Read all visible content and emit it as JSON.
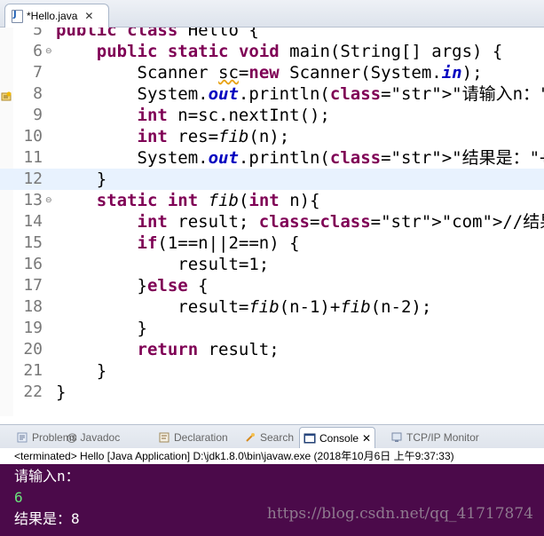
{
  "editor": {
    "tab": {
      "title": "*Hello.java",
      "close": "✕"
    },
    "current_line": "12",
    "lines": [
      {
        "num": "5",
        "text": "public class Hello {"
      },
      {
        "num": "6",
        "text": "    public static void main(String[] args) {"
      },
      {
        "num": "7",
        "text": "        Scanner sc=new Scanner(System.in);"
      },
      {
        "num": "8",
        "text": "        System.out.println(\"请输入n：\");"
      },
      {
        "num": "9",
        "text": "        int n=sc.nextInt();"
      },
      {
        "num": "10",
        "text": "        int res=fib(n);"
      },
      {
        "num": "11",
        "text": "        System.out.println(\"结果是：\"+res);"
      },
      {
        "num": "12",
        "text": "    }"
      },
      {
        "num": "13",
        "text": "    static int fib(int n){"
      },
      {
        "num": "14",
        "text": "        int result; //结果"
      },
      {
        "num": "15",
        "text": "        if(1==n||2==n) {"
      },
      {
        "num": "16",
        "text": "            result=1;"
      },
      {
        "num": "17",
        "text": "        }else {"
      },
      {
        "num": "18",
        "text": "            result=fib(n-1)+fib(n-2);"
      },
      {
        "num": "19",
        "text": "        }"
      },
      {
        "num": "20",
        "text": "        return result;"
      },
      {
        "num": "21",
        "text": "    }"
      },
      {
        "num": "22",
        "text": "}"
      }
    ]
  },
  "views": {
    "tabs": [
      {
        "label": "Problems",
        "icon": "problems-icon"
      },
      {
        "label": "@ Javadoc",
        "icon": "javadoc-icon"
      },
      {
        "label": "Declaration",
        "icon": "declaration-icon"
      },
      {
        "label": "Search",
        "icon": "search-icon"
      },
      {
        "label": "Console",
        "icon": "console-icon",
        "active": true,
        "close": "✕"
      },
      {
        "label": "TCP/IP Monitor",
        "icon": "monitor-icon"
      }
    ]
  },
  "console": {
    "status": "<terminated> Hello [Java Application] D:\\jdk1.8.0\\bin\\javaw.exe (2018年10月6日 上午9:37:33)",
    "lines": [
      {
        "text": "请输入n：",
        "kind": "output"
      },
      {
        "text": "6",
        "kind": "input"
      },
      {
        "text": "结果是：8",
        "kind": "output"
      }
    ],
    "watermark": "https://blog.csdn.net/qq_41717874",
    "bg_color": "#4b0a4a",
    "input_color": "#6be37c"
  }
}
